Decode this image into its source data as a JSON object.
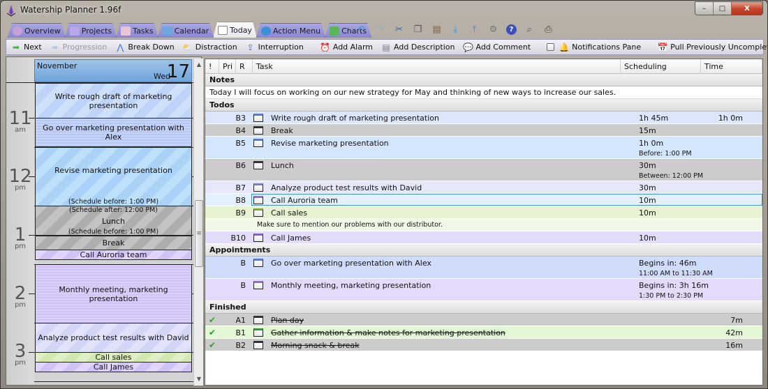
{
  "window": {
    "title": "Watership Planner 1.96f",
    "controls": {
      "minimize": "–",
      "maximize": "□",
      "close": "X"
    }
  },
  "tabs": [
    {
      "label": "Overview",
      "icon": "ship-wheel-icon",
      "color": "#c8a0d8",
      "active": false
    },
    {
      "label": "Projects",
      "icon": "projects-icon",
      "color": "#b9a7e9",
      "active": false
    },
    {
      "label": "Tasks",
      "icon": "tasks-icon",
      "color": "#e8c4d8",
      "active": false
    },
    {
      "label": "Calendar",
      "icon": "calendar-icon",
      "color": "#6fa5dc",
      "active": false
    },
    {
      "label": "Today",
      "icon": "fork-knife-icon",
      "color": "#cccccc",
      "active": true
    },
    {
      "label": "Action Menu",
      "icon": "action-arrow-icon",
      "color": "#3a8fd8",
      "active": false
    },
    {
      "label": "Charts",
      "icon": "chart-icon",
      "color": "#5bb55b",
      "active": false
    }
  ],
  "quick_actions": [
    {
      "name": "undo-icon",
      "glyph": "↶"
    },
    {
      "name": "redo-icon",
      "glyph": "↷"
    },
    {
      "name": "cut-icon",
      "glyph": "✂"
    },
    {
      "name": "copy-icon",
      "glyph": "❐"
    },
    {
      "name": "paste-icon",
      "glyph": "📋"
    },
    {
      "name": "import-icon",
      "glyph": "⤓"
    },
    {
      "name": "export-icon",
      "glyph": "⤒"
    },
    {
      "name": "settings-gear-icon",
      "glyph": "⚙"
    },
    {
      "name": "help-icon",
      "glyph": "?"
    },
    {
      "name": "print-preview-icon",
      "glyph": "🔍"
    },
    {
      "name": "print-icon",
      "glyph": "🖶"
    }
  ],
  "toolbar": {
    "next": "Next",
    "progression": "Progression",
    "break_down": "Break Down",
    "distraction": "Distraction",
    "interruption": "Interruption",
    "add_alarm": "Add Alarm",
    "add_description": "Add Description",
    "add_comment": "Add Comment",
    "notifications_pane": "Notifications Pane",
    "pull_uncompleted": "Pull Previously Uncompleted Tasks"
  },
  "calendar": {
    "month": "November",
    "weekday": "Wed",
    "day": "17",
    "hours": [
      {
        "n": "11",
        "ap": "am"
      },
      {
        "n": "12",
        "ap": "pm"
      },
      {
        "n": "1",
        "ap": "pm"
      },
      {
        "n": "2",
        "ap": "pm"
      },
      {
        "n": "3",
        "ap": "pm"
      }
    ],
    "events": [
      {
        "title": "Write rough draft of marketing presentation",
        "pre": "",
        "post": ""
      },
      {
        "title": "Go over marketing presentation with Alex",
        "pre": "",
        "post": ""
      },
      {
        "title": "Revise marketing presentation",
        "pre": "",
        "post": "(Schedule before: 1:00 PM)"
      },
      {
        "title": "Lunch",
        "pre": "(Schedule after: 12:00 PM)",
        "post": "(Schedule before: 1:00 PM)"
      },
      {
        "title": "Break",
        "pre": "",
        "post": ""
      },
      {
        "title": "Call Auroria team",
        "pre": "",
        "post": ""
      },
      {
        "title": "Monthly meeting, marketing presentation",
        "pre": "",
        "post": ""
      },
      {
        "title": "Analyze product test results with David",
        "pre": "",
        "post": ""
      },
      {
        "title": "Call sales",
        "pre": "",
        "post": ""
      },
      {
        "title": "Call James",
        "pre": "",
        "post": ""
      }
    ]
  },
  "grid": {
    "columns": [
      "!",
      "Pri",
      "R",
      "Task",
      "Scheduling",
      "Time"
    ],
    "sections": {
      "notes": "Notes",
      "todos": "Todos",
      "appointments": "Appointments",
      "finished": "Finished"
    },
    "note_text": "Today I will focus on working on our new strategy for May and thinking of new ways to increase our sales.",
    "todos": [
      {
        "pri": "B3",
        "task": "Write rough draft of marketing presentation",
        "sched": "1h 45m",
        "sched_sub": "",
        "time": "1h 0m",
        "bg": "#dbe6fb",
        "r_color": "#4d7fd8"
      },
      {
        "pri": "B4",
        "task": "Break",
        "sched": "15m",
        "sched_sub": "",
        "time": "",
        "bg": "#cccccc",
        "r_color": "#333333"
      },
      {
        "pri": "B5",
        "task": "Revise marketing presentation",
        "sched": "1h 0m",
        "sched_sub": "Before: 1:00 PM",
        "time": "",
        "bg": "#d3e6fb",
        "r_color": "#4d7fd8"
      },
      {
        "pri": "B6",
        "task": "Lunch",
        "sched": "30m",
        "sched_sub": "Between: 12:00 PM a...",
        "time": "",
        "bg": "#cccccc",
        "r_color": "#333333"
      },
      {
        "pri": "B7",
        "task": "Analyze product test results with David",
        "sched": "30m",
        "sched_sub": "",
        "time": "",
        "bg": "#e6e7fb",
        "r_color": "#7a7ad8"
      },
      {
        "pri": "B8",
        "task": "Call Auroria team",
        "sched": "10m",
        "sched_sub": "",
        "time": "",
        "bg": "#e3f0fd",
        "r_color": "#9a6ad8",
        "selected": true
      },
      {
        "pri": "B9",
        "task": "Call sales",
        "sched": "10m",
        "sched_sub": "",
        "time": "",
        "bg": "#e7f2d2",
        "r_color": "#7ab020",
        "memo": "Make sure to mention our problems with our distributor."
      },
      {
        "pri": "B10",
        "task": "Call James",
        "sched": "10m",
        "sched_sub": "",
        "time": "",
        "bg": "#e4dcfb",
        "r_color": "#8a5ad8"
      }
    ],
    "appointments": [
      {
        "pri": "B",
        "task": "Go over marketing presentation with Alex",
        "sched": "Begins in: 46m",
        "sched_sub": "11:00 AM to 11:30 AM",
        "time": "",
        "bg": "#cfdcfb",
        "r_color": "#4d7fd8"
      },
      {
        "pri": "B",
        "task": "Monthly meeting, marketing presentation",
        "sched": "Begins in: 3h 16m",
        "sched_sub": "1:30 PM to 2:30 PM",
        "time": "",
        "bg": "#e4dbfb",
        "r_color": "#9a6ad8"
      }
    ],
    "finished": [
      {
        "pri": "A1",
        "task": "Plan day",
        "time": "7m",
        "bg": "#cccccc",
        "r_color": "#333333"
      },
      {
        "pri": "B1",
        "task": "Gather information & make notes for marketing presentation",
        "time": "42m",
        "bg": "#e2f7d6",
        "r_color": "#2aa02a"
      },
      {
        "pri": "B2",
        "task": "Morning snack & break",
        "time": "16m",
        "bg": "#cccccc",
        "r_color": "#333333"
      }
    ]
  }
}
